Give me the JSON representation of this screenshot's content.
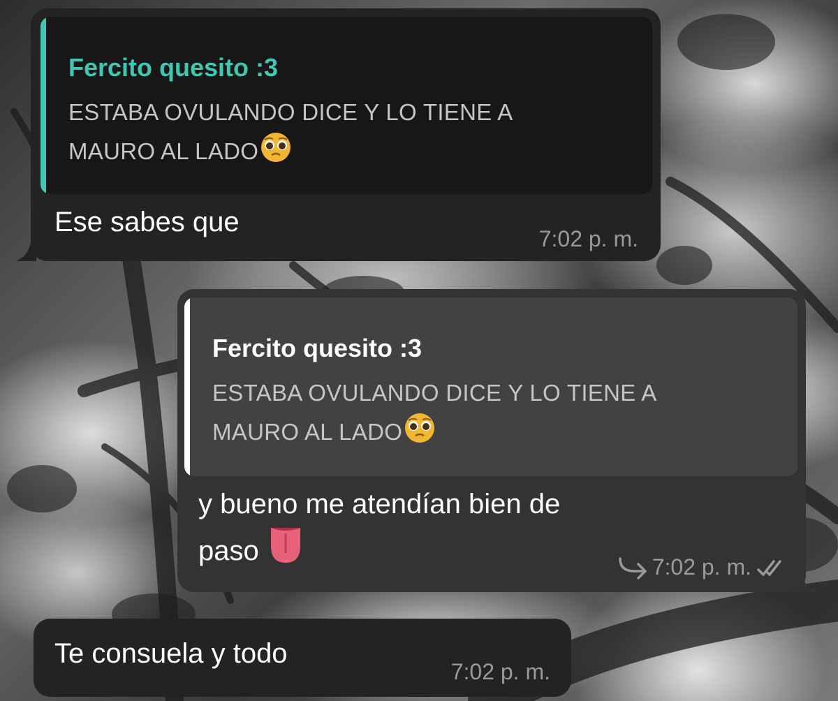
{
  "messages": [
    {
      "direction": "incoming",
      "quote": {
        "author": "Fercito quesito :3",
        "text_line1": "ESTABA OVULANDO DICE Y LO TIENE A",
        "text_line2": "MAURO AL LADO",
        "emoji": "pleading-face-emoji",
        "accent": "#3fc7b1"
      },
      "text": "Ese sabes que",
      "time": "7:02 p. m."
    },
    {
      "direction": "outgoing",
      "quote": {
        "author": "Fercito quesito :3",
        "text_line1": "ESTABA OVULANDO DICE Y LO TIENE A",
        "text_line2": "MAURO AL LADO",
        "emoji": "pleading-face-emoji",
        "accent": "#ffffff"
      },
      "text_line1": "y bueno me atendían bien de",
      "text_line2": "paso",
      "emoji": "tongue-emoji",
      "time": "7:02 p. m.",
      "forwarded_icon": "forward-arrow-icon",
      "status_icon": "double-check-icon"
    },
    {
      "direction": "incoming",
      "text": "Te consuela y todo",
      "time": "7:02 p. m."
    }
  ],
  "colors": {
    "incoming_bubble": "#232323",
    "outgoing_bubble": "#333333",
    "quote_bg_incoming": "#171717",
    "quote_bg_outgoing": "#424242",
    "incoming_accent": "#3fc7b1"
  }
}
